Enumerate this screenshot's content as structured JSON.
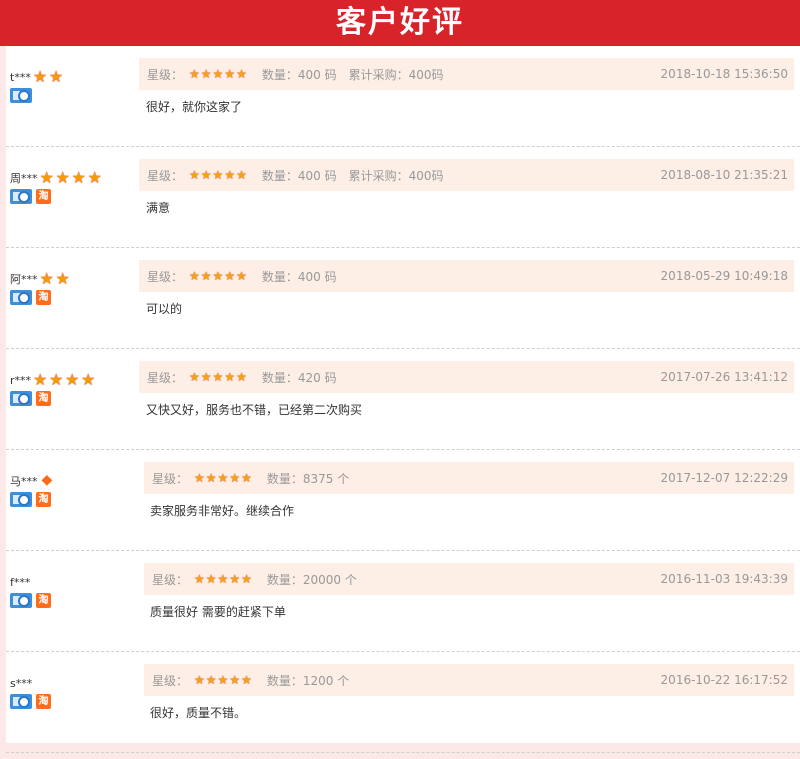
{
  "header": {
    "title": "客户好评"
  },
  "labels": {
    "star_label": "星级："
  },
  "reviews": [
    {
      "user": "t***",
      "medals": 2,
      "diamond": false,
      "taobao": false,
      "qty": "数量：400 码",
      "cumulative": "累计采购：400码",
      "date": "2018-10-18 15:36:50",
      "comment": "很好，就你这家了"
    },
    {
      "user": "周***",
      "medals": 4,
      "diamond": false,
      "taobao": true,
      "qty": "数量：400 码",
      "cumulative": "累计采购：400码",
      "date": "2018-08-10 21:35:21",
      "comment": "满意"
    },
    {
      "user": "阿***",
      "medals": 2,
      "diamond": false,
      "taobao": true,
      "qty": "数量：400 码",
      "cumulative": "",
      "date": "2018-05-29 10:49:18",
      "comment": "可以的"
    },
    {
      "user": "r***",
      "medals": 4,
      "diamond": false,
      "taobao": true,
      "qty": "数量：420 码",
      "cumulative": "",
      "date": "2017-07-26 13:41:12",
      "comment": "又快又好，服务也不错，已经第二次购买"
    },
    {
      "user": "马***",
      "medals": 0,
      "diamond": true,
      "taobao": true,
      "qty": "数量：8375 个",
      "cumulative": "",
      "date": "2017-12-07 12:22:29",
      "comment": "卖家服务非常好。继续合作"
    },
    {
      "user": "f***",
      "medals": 0,
      "diamond": false,
      "taobao": true,
      "qty": "数量：20000 个",
      "cumulative": "",
      "date": "2016-11-03 19:43:39",
      "comment": "质量很好 需要的赶紧下单"
    },
    {
      "user": "s***",
      "medals": 0,
      "diamond": false,
      "taobao": true,
      "qty": "数量：1200 个",
      "cumulative": "",
      "date": "2016-10-22 16:17:52",
      "comment": "很好，质量不错。"
    }
  ],
  "icons": {
    "medal": "medal-star-icon",
    "diamond": "diamond-icon",
    "id": "id-verified-icon",
    "taobao": "taobao-icon",
    "rating_star": "rating-star-icon"
  },
  "colors": {
    "header_bg": "#d8232a",
    "info_bg": "#fdeee6",
    "star": "#f3a60c"
  },
  "taobao_char": "淘",
  "rating_stars": 5
}
